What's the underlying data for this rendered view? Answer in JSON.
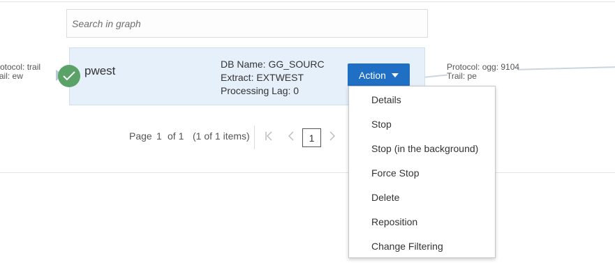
{
  "search": {
    "placeholder": "Search in graph"
  },
  "left_labels": {
    "line1": "Protocol: trail",
    "line2": "Trail: ew"
  },
  "right_labels": {
    "line1": "Protocol: ogg: 9104",
    "line2": "Trail: pe"
  },
  "card": {
    "name": "pwest",
    "status_color": "#5aa267",
    "db_name": "DB Name: GG_SOURC",
    "extract": "Extract: EXTWEST",
    "lag": "Processing Lag: 0"
  },
  "action": {
    "label": "Action",
    "color": "#1f6fc5"
  },
  "menu": {
    "items": [
      "Details",
      "Stop",
      "Stop (in the background)",
      "Force Stop",
      "Delete",
      "Reposition",
      "Change Filtering"
    ]
  },
  "pagination": {
    "page_label": "Page",
    "current": "1",
    "of_label": "of 1",
    "items_label": "(1 of 1 items)",
    "page_button": "1"
  }
}
